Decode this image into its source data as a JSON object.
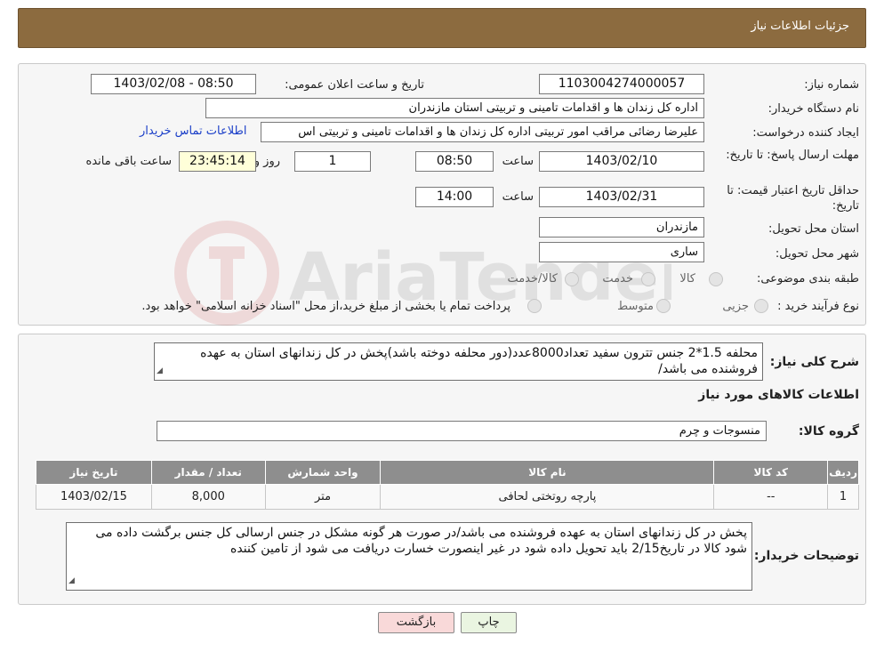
{
  "header": {
    "title": "جزئیات اطلاعات نیاز"
  },
  "form": {
    "need_number_label": "شماره نیاز:",
    "need_number": "1103004274000057",
    "announce_label": "تاریخ و ساعت اعلان عمومی:",
    "announce_value": "1403/02/08 - 08:50",
    "buyer_org_label": "نام دستگاه خریدار:",
    "buyer_org": "اداره کل زندان ها و اقدامات تامینی و تربیتی استان مازندران",
    "creator_label": "ایجاد کننده درخواست:",
    "creator": "علیرضا رضائی مراقب امور تربیتی اداره کل زندان ها و اقدامات تامینی و تربیتی اس",
    "contact_link": "اطلاعات تماس خریدار",
    "deadline_label": "مهلت ارسال پاسخ: تا تاریخ:",
    "deadline_date": "1403/02/10",
    "time_label": "ساعت",
    "deadline_time": "08:50",
    "days_value": "1",
    "days_label": "روز و",
    "remaining_time": "23:45:14",
    "remaining_label": "ساعت باقی مانده",
    "validity_label": "حداقل تاریخ اعتبار قیمت: تا تاریخ:",
    "validity_date": "1403/02/31",
    "validity_time": "14:00",
    "province_label": "استان محل تحویل:",
    "province": "مازندران",
    "city_label": "شهر محل تحویل:",
    "city": "ساری",
    "category_label": "طبقه بندی موضوعی:",
    "category_options": [
      "کالا",
      "خدمت",
      "کالا/خدمت"
    ],
    "process_label": "نوع فرآیند خرید :",
    "process_options": [
      "جزیی",
      "متوسط"
    ],
    "process_note": "پرداخت تمام یا بخشی از مبلغ خرید،از محل \"اسناد خزانه اسلامی\" خواهد بود."
  },
  "summary": {
    "label": "شرح کلی نیاز:",
    "text": "محلفه 1.5*2 جنس تترون سفید تعداد8000عدد(دور محلفه دوخته باشد)پخش در کل زندانهای استان به عهده فروشنده می باشد/",
    "goods_title": "اطلاعات کالاهای مورد نیاز",
    "group_label": "گروه کالا:",
    "group_value": "منسوجات و چرم"
  },
  "table": {
    "headers": [
      "ردیف",
      "کد کالا",
      "نام کالا",
      "واحد شمارش",
      "تعداد / مقدار",
      "تاریخ نیاز"
    ],
    "rows": [
      [
        "1",
        "--",
        "پارچه روتختی لحافی",
        "متر",
        "8,000",
        "1403/02/15"
      ]
    ]
  },
  "buyer_notes": {
    "label": "توضیحات خریدار:",
    "text": "پخش در کل زندانهای استان به عهده فروشنده می باشد/در صورت هر گونه مشکل در جنس ارسالی کل جنس برگشت داده می شود کالا در تاریخ2/15 باید تحویل داده شود در غیر اینصورت خسارت دریافت می شود از تامین کننده"
  },
  "buttons": {
    "print": "چاپ",
    "back": "بازگشت"
  },
  "watermark": {
    "text": "AriaTender.neT"
  },
  "colors": {
    "header": "#8c6b3f",
    "table_header": "#8e8e8e",
    "link": "#1a3ec8",
    "back_button": "#f9d9d9"
  }
}
